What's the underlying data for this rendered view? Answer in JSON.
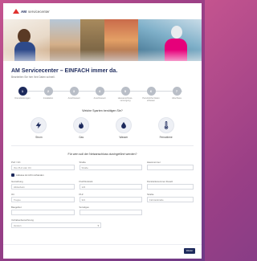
{
  "header": {
    "logo_text": "AM",
    "logo_sub": "servicecenter"
  },
  "main": {
    "title": "AM Servicecenter – EINFACH immer da.",
    "subtitle": "Bearbeiten Sie hier Ihre Daten schnell."
  },
  "steps": [
    {
      "num": "1",
      "label": "Dienstleistungen",
      "active": true
    },
    {
      "num": "2",
      "label": "Installation",
      "active": false
    },
    {
      "num": "3",
      "label": "Anschlussart",
      "active": false
    },
    {
      "num": "4",
      "label": "Anschlussart",
      "active": false
    },
    {
      "num": "5",
      "label": "Hausanschluss-\nversorgung",
      "active": false
    },
    {
      "num": "6",
      "label": "Persönliche Daten\nerfassen",
      "active": false
    },
    {
      "num": "7",
      "label": "Abschluss",
      "active": false
    }
  ],
  "services_section": {
    "title": "Welche Sparten benötigen Sie?",
    "items": [
      {
        "name": "Strom",
        "icon": "bolt-icon"
      },
      {
        "name": "Gas",
        "icon": "flame-icon"
      },
      {
        "name": "Wasser",
        "icon": "drop-icon"
      },
      {
        "name": "Fernwärme",
        "icon": "thermometer-icon"
      }
    ]
  },
  "request_section": {
    "title": "Für wen soll der Netzanschluss durchgeführt werden?",
    "fields": {
      "plz_label": "PLZ / Ort",
      "plz_placeholder": "Ihre PLZ oder Ort",
      "strasse_label": "Straße",
      "strasse_placeholder": "Straße",
      "hausnr_label": "Hausnummer",
      "hausnr_placeholder": "",
      "checkbox_label": "Adresse ist nicht vorhanden",
      "gemarkung_label": "Gemarkung",
      "gemarkung_value": "Hildesheim",
      "flur_label": "Flur/Flurstück",
      "flur_value": "123",
      "flurstueck_label": "Flurstücksnummer Zusatz",
      "flurstueck_value": "",
      "ort_label": "Ort",
      "ort_value": "Treppe",
      "plz2_label": "PLZ",
      "plz2_value": "321",
      "strasse2_label": "Straße",
      "strasse2_value": "Fahrradstraße",
      "bauort_label": "Baugebiet",
      "bauort_value": "",
      "sonstiges_label": "Sonstiges",
      "sonstiges_value": "",
      "vorhaben_label": "Vorhabenbezeichnung",
      "vorhaben_value": "Hessen"
    }
  },
  "footer": {
    "next_label": "Weiter"
  },
  "colors": {
    "primary": "#1d2a5c",
    "brand_red": "#e0312e",
    "background_gradient_start": "#c4548f",
    "background_gradient_end": "#6e3a86"
  }
}
